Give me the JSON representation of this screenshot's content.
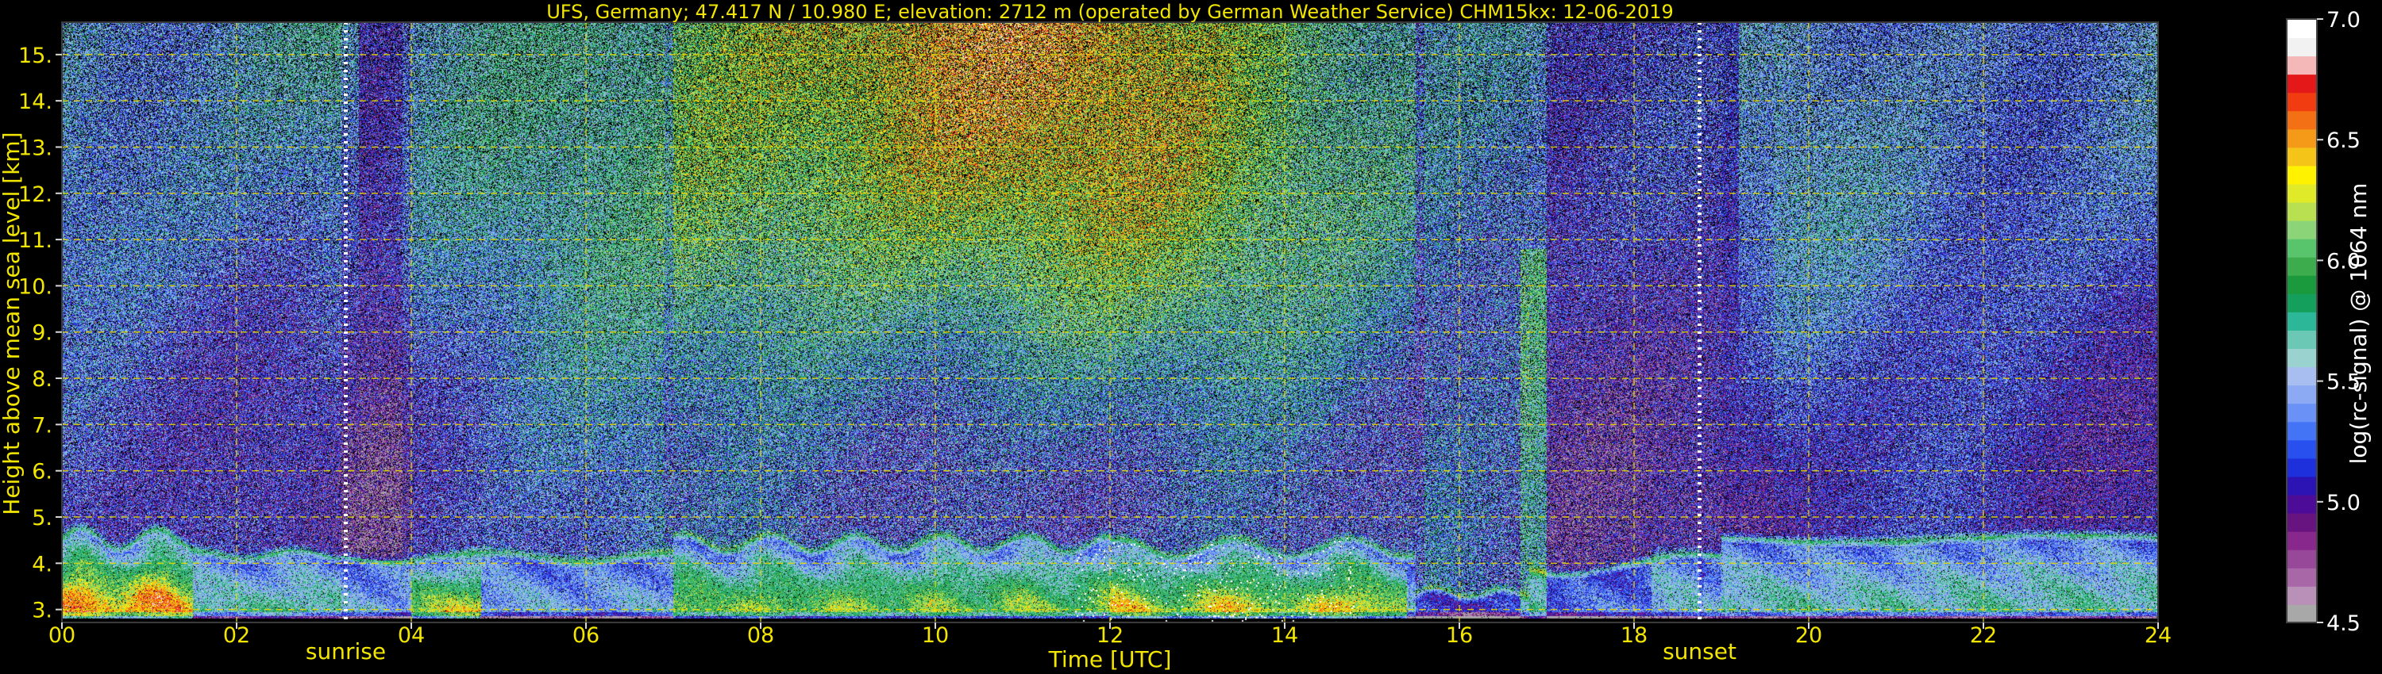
{
  "chart_data": {
    "type": "heatmap",
    "title": "UFS, Germany; 47.417 N / 10.980 E; elevation: 2712 m  (operated by German Weather Service)    CHM15kx: 12-06-2019",
    "xlabel": "Time [UTC]",
    "ylabel": "Height above mean sea level [km]",
    "colorbar_label": "log(rc-signal) @ 1064 nm",
    "xlim": [
      0,
      24
    ],
    "ylim": [
      2.72,
      15.7
    ],
    "x_ticks": [
      {
        "value": 0,
        "label": "00"
      },
      {
        "value": 2,
        "label": "02"
      },
      {
        "value": 4,
        "label": "04"
      },
      {
        "value": 6,
        "label": "06"
      },
      {
        "value": 8,
        "label": "08"
      },
      {
        "value": 10,
        "label": "10"
      },
      {
        "value": 12,
        "label": "12"
      },
      {
        "value": 14,
        "label": "14"
      },
      {
        "value": 16,
        "label": "16"
      },
      {
        "value": 18,
        "label": "18"
      },
      {
        "value": 20,
        "label": "20"
      },
      {
        "value": 22,
        "label": "22"
      },
      {
        "value": 24,
        "label": "24"
      }
    ],
    "y_ticks": [
      {
        "value": 3,
        "label": "3."
      },
      {
        "value": 4,
        "label": "4."
      },
      {
        "value": 5,
        "label": "5."
      },
      {
        "value": 6,
        "label": "6."
      },
      {
        "value": 7,
        "label": "7."
      },
      {
        "value": 8,
        "label": "8."
      },
      {
        "value": 9,
        "label": "9."
      },
      {
        "value": 10,
        "label": "10."
      },
      {
        "value": 11,
        "label": "11."
      },
      {
        "value": 12,
        "label": "12."
      },
      {
        "value": 13,
        "label": "13."
      },
      {
        "value": 14,
        "label": "14."
      },
      {
        "value": 15,
        "label": "15."
      }
    ],
    "grid": true,
    "events": [
      {
        "name": "sunrise",
        "label": "sunrise",
        "time": 3.25
      },
      {
        "name": "sunset",
        "label": "sunset",
        "time": 18.75
      }
    ],
    "colorbar": {
      "range": [
        4.5,
        7.0
      ],
      "ticks": [
        {
          "value": 4.5,
          "label": "4.5"
        },
        {
          "value": 5.0,
          "label": "5.0"
        },
        {
          "value": 5.5,
          "label": "5.5"
        },
        {
          "value": 6.0,
          "label": "6.0"
        },
        {
          "value": 6.5,
          "label": "6.5"
        },
        {
          "value": 7.0,
          "label": "7.0"
        }
      ],
      "colors": [
        "#a8a8a8",
        "#b890b8",
        "#a868a8",
        "#984898",
        "#88288c",
        "#681480",
        "#4c0c98",
        "#2c14b4",
        "#1e30dc",
        "#2850ee",
        "#4474f6",
        "#6a92f6",
        "#8caaf4",
        "#a8bef0",
        "#9ad2d0",
        "#6ac8b4",
        "#2cb898",
        "#14a05c",
        "#1a9a3c",
        "#3cac4c",
        "#58c46c",
        "#8cd478",
        "#b8e050",
        "#e0ea28",
        "#fff200",
        "#f4c418",
        "#f49a18",
        "#f47014",
        "#f03c10",
        "#e41818",
        "#f4b8b8",
        "#f2f2f2",
        "#ffffff"
      ]
    },
    "colors": {
      "background": "#000000",
      "text": "#f2e600",
      "grid": "#e8dc00"
    }
  }
}
